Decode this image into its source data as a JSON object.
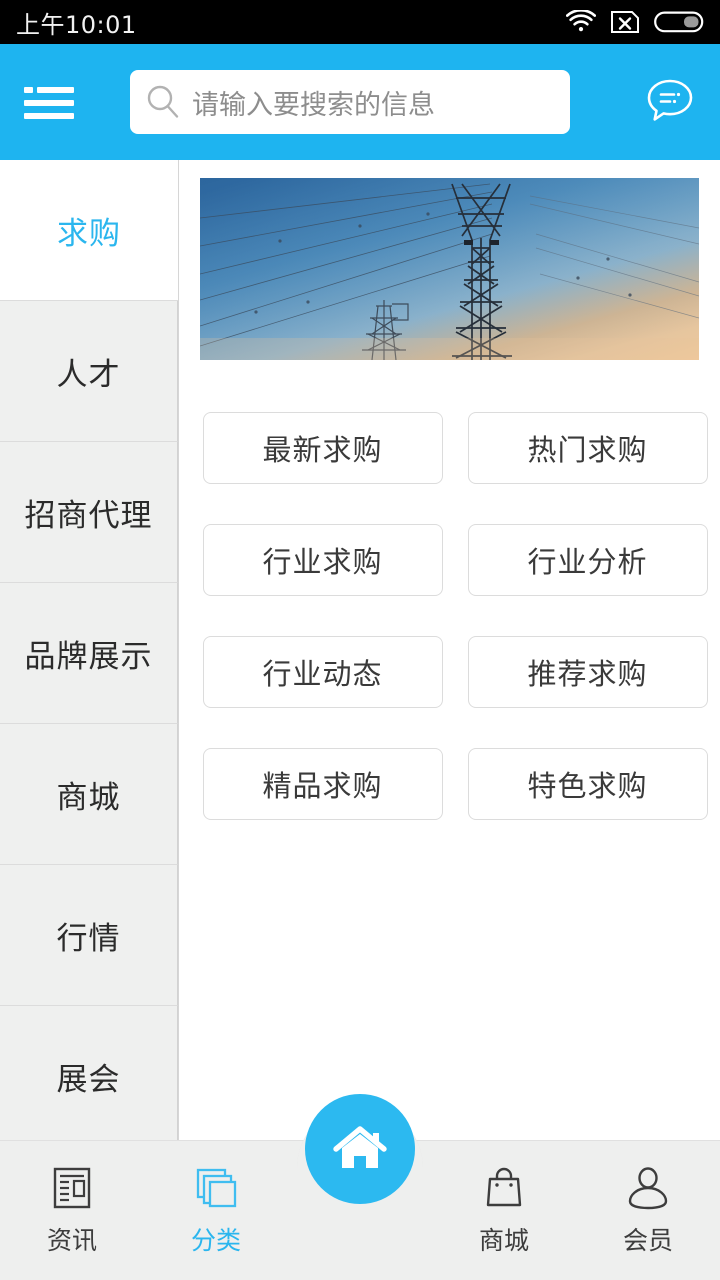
{
  "status_bar": {
    "time": "上午10:01",
    "icons": [
      "wifi-icon",
      "sim-no-service-icon",
      "battery-icon"
    ]
  },
  "header": {
    "menu_icon": "hamburger-menu-icon",
    "search": {
      "icon": "search-icon",
      "placeholder": "请输入要搜索的信息",
      "value": ""
    },
    "message_icon": "message-bubble-icon",
    "background_color": "#1EB4F0"
  },
  "sidebar": {
    "active_color": "#2BB6EE",
    "items": [
      {
        "label": "求购",
        "active": true
      },
      {
        "label": "人才",
        "active": false
      },
      {
        "label": "招商代理",
        "active": false
      },
      {
        "label": "品牌展示",
        "active": false
      },
      {
        "label": "商城",
        "active": false
      },
      {
        "label": "行情",
        "active": false
      },
      {
        "label": "展会",
        "active": false
      }
    ]
  },
  "main": {
    "banner": {
      "name": "power-transmission-towers-banner",
      "alt": "高压输电塔黄昏天空"
    },
    "tiles": [
      {
        "label": "最新求购"
      },
      {
        "label": "热门求购"
      },
      {
        "label": "行业求购"
      },
      {
        "label": "行业分析"
      },
      {
        "label": "行业动态"
      },
      {
        "label": "推荐求购"
      },
      {
        "label": "精品求购"
      },
      {
        "label": "特色求购"
      }
    ]
  },
  "tabbar": {
    "accent_color": "#2CB9F0",
    "items": [
      {
        "label": "资讯",
        "icon": "news-icon",
        "active": false
      },
      {
        "label": "分类",
        "icon": "categories-layers-icon",
        "active": true
      },
      {
        "label": "",
        "icon": "home-icon",
        "active": false,
        "center": true
      },
      {
        "label": "商城",
        "icon": "shopping-bag-icon",
        "active": false
      },
      {
        "label": "会员",
        "icon": "member-person-icon",
        "active": false
      }
    ]
  }
}
